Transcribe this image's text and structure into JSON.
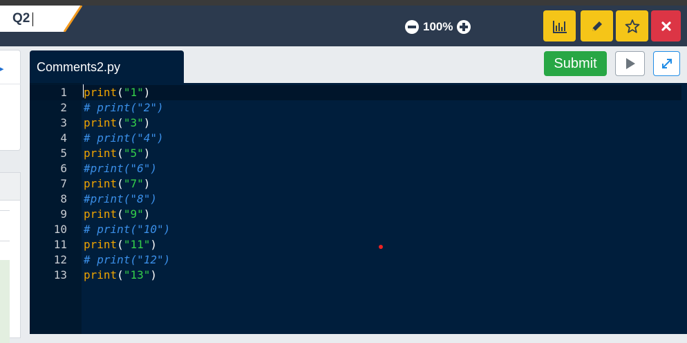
{
  "header": {
    "question_label": "Q2",
    "zoom_level": "100%",
    "buttons": {
      "stats_icon": "bar-chart-icon",
      "edit_icon": "pencil-icon",
      "bookmark_icon": "star-icon",
      "close_icon": "close-icon"
    },
    "colors": {
      "bar": "#2c3a4e",
      "yellow": "#f5c518",
      "red": "#dc3545",
      "tab_accent": "#f39a1e"
    }
  },
  "editor": {
    "file_name": "Comments2.py",
    "submit_label": "Submit",
    "run_icon": "play-icon",
    "fullscreen_icon": "expand-icon",
    "lines": [
      {
        "n": "1",
        "fn": "print",
        "open": "(",
        "str": "\"1\"",
        "close": ")",
        "comment": ""
      },
      {
        "n": "2",
        "comment": "# print(\"2\")"
      },
      {
        "n": "3",
        "fn": "print",
        "open": "(",
        "str": "\"3\"",
        "close": ")",
        "comment": ""
      },
      {
        "n": "4",
        "comment": "# print(\"4\")"
      },
      {
        "n": "5",
        "fn": "print",
        "open": "(",
        "str": "\"5\"",
        "close": ")",
        "comment": ""
      },
      {
        "n": "6",
        "comment": "#print(\"6\")"
      },
      {
        "n": "7",
        "fn": "print",
        "open": "(",
        "str": "\"7\"",
        "close": ")",
        "comment": ""
      },
      {
        "n": "8",
        "comment": "#print(\"8\")"
      },
      {
        "n": "9",
        "fn": "print",
        "open": "(",
        "str": "\"9\"",
        "close": ")",
        "comment": ""
      },
      {
        "n": "10",
        "comment": "# print(\"10\")"
      },
      {
        "n": "11",
        "fn": "print",
        "open": "(",
        "str": "\"11\"",
        "close": ")",
        "comment": ""
      },
      {
        "n": "12",
        "comment": "# print(\"12\")"
      },
      {
        "n": "13",
        "fn": "print",
        "open": "(",
        "str": "\"13\"",
        "close": ")",
        "comment": ""
      }
    ]
  }
}
